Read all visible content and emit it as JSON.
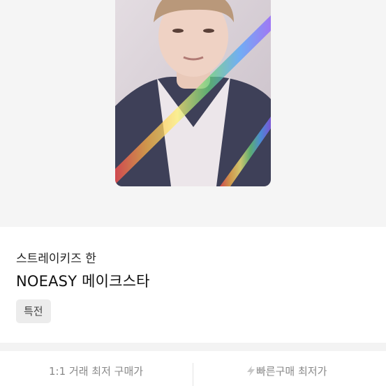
{
  "product": {
    "artist": "스트레이키즈 한",
    "title": "NOEASY 메이크스타",
    "tag": "특전"
  },
  "price_bar": {
    "left_label": "1:1 거래 최저 구매가",
    "right_label": "빠른구매 최저가",
    "right_icon": "lightning-icon"
  },
  "colors": {
    "page_bg": "#f5f5f5",
    "text_primary": "#111111",
    "text_muted": "#888888",
    "tag_bg": "#ececec"
  }
}
